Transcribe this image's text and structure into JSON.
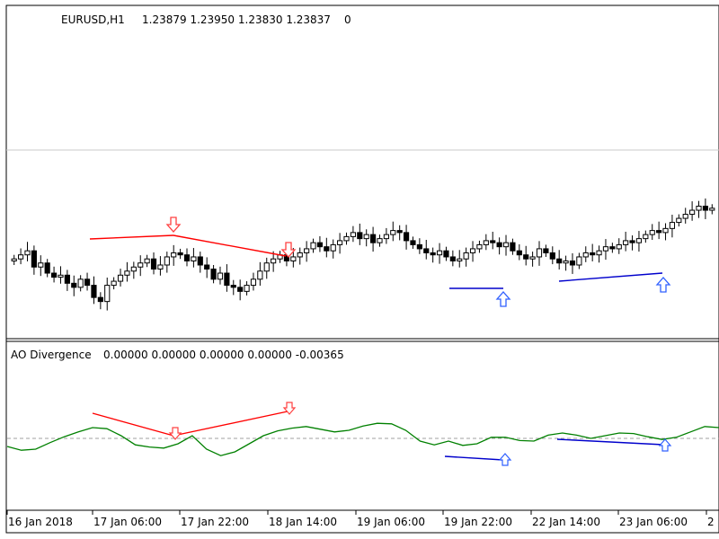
{
  "header": {
    "symbol": "EURUSD,H1",
    "ohlc": "1.23879 1.23950 1.23830 1.23837",
    "extra": "0"
  },
  "icons": [
    "table-icon",
    "chart-type-icon"
  ],
  "indicator": {
    "name": "AO Divergence",
    "values": "0.00000 0.00000 0.00000 0.00000 -0.00365"
  },
  "colors": {
    "bearish_divergence": "#ff0000",
    "bullish_divergence": "#0000cc",
    "oscillator": "#008000",
    "candle": "#000000",
    "zero_line": "#a0a0a0",
    "bearish_arrow": "#ff4040",
    "bullish_arrow": "#3060ff"
  },
  "xaxis_labels": [
    "16 Jan 2018",
    "17 Jan 06:00",
    "17 Jan 22:00",
    "18 Jan 14:00",
    "19 Jan 06:00",
    "19 Jan 22:00",
    "22 Jan 14:00",
    "23 Jan 06:00",
    "2"
  ],
  "chart_data": [
    {
      "type": "candlestick",
      "name": "EURUSD,H1",
      "grid": false,
      "closes": [
        0.34,
        0.36,
        0.38,
        0.3,
        0.32,
        0.27,
        0.25,
        0.26,
        0.22,
        0.2,
        0.24,
        0.21,
        0.15,
        0.13,
        0.21,
        0.23,
        0.26,
        0.28,
        0.3,
        0.32,
        0.34,
        0.29,
        0.31,
        0.35,
        0.37,
        0.36,
        0.33,
        0.35,
        0.31,
        0.29,
        0.24,
        0.27,
        0.21,
        0.2,
        0.18,
        0.21,
        0.24,
        0.28,
        0.32,
        0.34,
        0.36,
        0.33,
        0.35,
        0.37,
        0.39,
        0.42,
        0.4,
        0.38,
        0.41,
        0.43,
        0.45,
        0.47,
        0.44,
        0.46,
        0.42,
        0.44,
        0.46,
        0.48,
        0.47,
        0.43,
        0.41,
        0.39,
        0.37,
        0.36,
        0.38,
        0.35,
        0.33,
        0.34,
        0.37,
        0.39,
        0.41,
        0.43,
        0.42,
        0.4,
        0.42,
        0.38,
        0.36,
        0.34,
        0.35,
        0.39,
        0.37,
        0.34,
        0.32,
        0.33,
        0.31,
        0.35,
        0.37,
        0.36,
        0.38,
        0.4,
        0.39,
        0.41,
        0.43,
        0.42,
        0.44,
        0.46,
        0.48,
        0.47,
        0.49,
        0.52,
        0.54,
        0.56,
        0.58,
        0.6,
        0.58,
        0.59
      ]
    },
    {
      "type": "line",
      "name": "AO Divergence",
      "zero_line": 0,
      "grid": false,
      "values": [
        -0.0015,
        -0.0022,
        -0.002,
        -0.0008,
        0.0003,
        0.0012,
        0.002,
        0.0018,
        0.0005,
        -0.0012,
        -0.0016,
        -0.0018,
        -0.001,
        0.0005,
        -0.002,
        -0.0032,
        -0.0025,
        -0.001,
        0.0005,
        0.0014,
        0.0019,
        0.0022,
        0.0017,
        0.0012,
        0.0015,
        0.0023,
        0.0028,
        0.0027,
        0.0015,
        -0.0005,
        -0.0012,
        -0.0005,
        -0.0013,
        -0.001,
        0.0002,
        0.0002,
        -0.0004,
        -0.0005,
        0.0006,
        0.001,
        0.0006,
        0.0,
        0.0005,
        0.001,
        0.0009,
        0.0003,
        -0.0002,
        0.0002,
        0.0012,
        0.0022,
        0.002
      ]
    }
  ]
}
